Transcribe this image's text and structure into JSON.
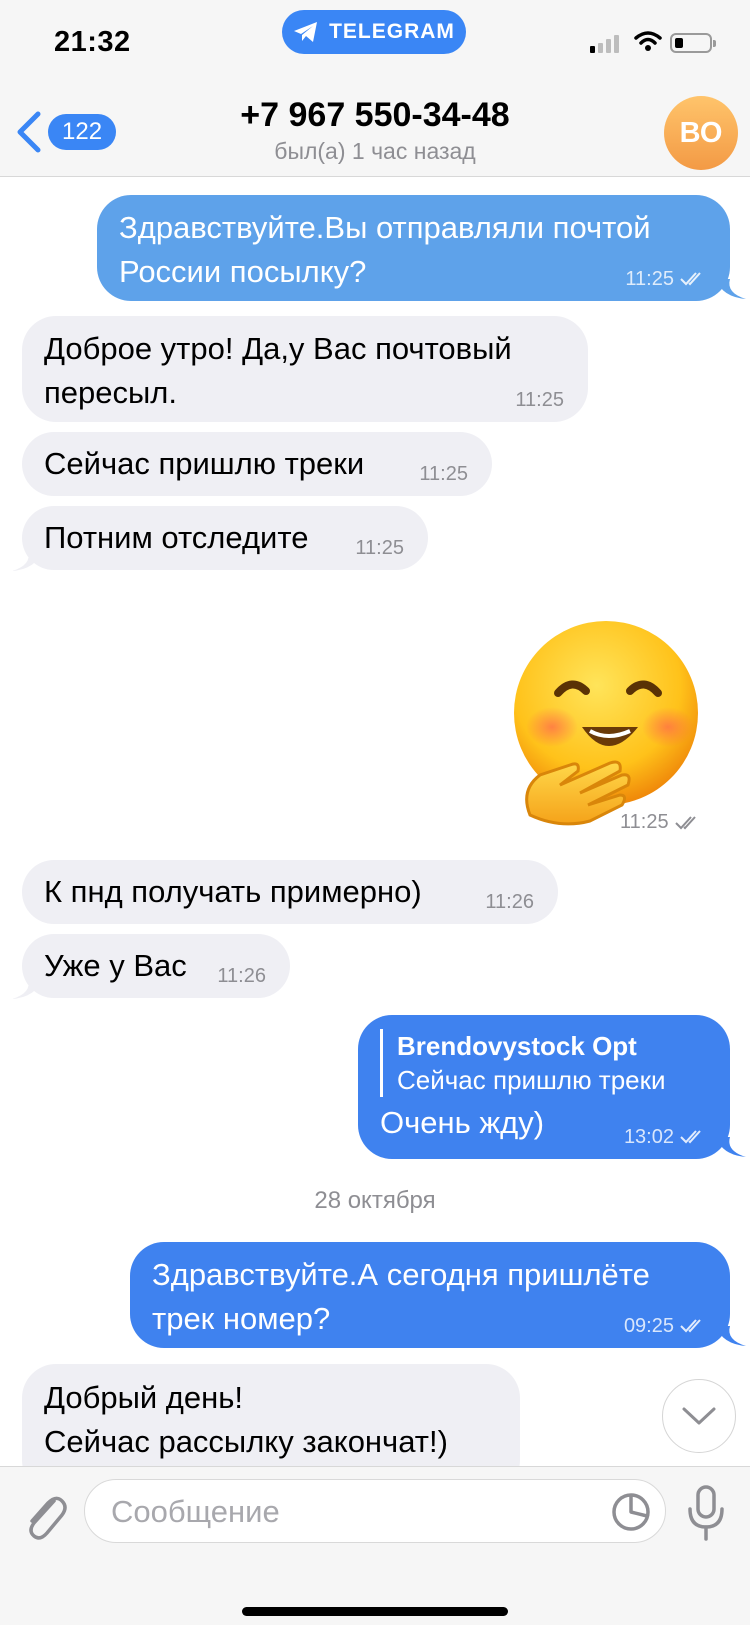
{
  "status_bar": {
    "time": "21:32",
    "app_pill": "TELEGRAM"
  },
  "header": {
    "back_count": "122",
    "title": "+7 967 550-34-48",
    "subtitle": "был(а) 1 час назад",
    "avatar_initials": "ВО"
  },
  "messages": [
    {
      "dir": "out",
      "text": "Здравствуйте.Вы отправляли почтой\nРоссии посылку?",
      "time": "11:25",
      "read": true
    },
    {
      "dir": "in",
      "text": "Доброе утро! Да,у Вас почтовый\nпересыл.",
      "time": "11:25"
    },
    {
      "dir": "in",
      "text": "Сейчас пришлю треки",
      "time": "11:25"
    },
    {
      "dir": "in",
      "text": "Потним отследите",
      "time": "11:25"
    },
    {
      "dir": "out",
      "type": "sticker",
      "icon": "smiling-face-hand-over-mouth-sticker",
      "time": "11:25",
      "read": true
    },
    {
      "dir": "in",
      "text": "К пнд получать примерно)",
      "time": "11:26"
    },
    {
      "dir": "in",
      "text": "Уже у Вас",
      "time": "11:26"
    },
    {
      "dir": "out",
      "reply_author": "Brendovystock Opt",
      "reply_text": "Сейчас пришлю треки",
      "text": "Очень жду)",
      "time": "13:02",
      "read": true
    },
    {
      "dir": "out",
      "text": "Здравствуйте.А сегодня пришлёте\nтрек номер?",
      "time": "09:25",
      "read": true
    },
    {
      "dir": "in",
      "text": "Добрый день!\nСейчас рассылку закончат!)"
    }
  ],
  "date_separator": "28 октября",
  "composer": {
    "placeholder": "Сообщение"
  },
  "colors": {
    "accent": "#3a86f5",
    "bubble_out": "#5ea2ea",
    "bubble_out_dark": "#3f82ef",
    "bubble_in": "#efeff4",
    "avatar": "#f5a550"
  }
}
